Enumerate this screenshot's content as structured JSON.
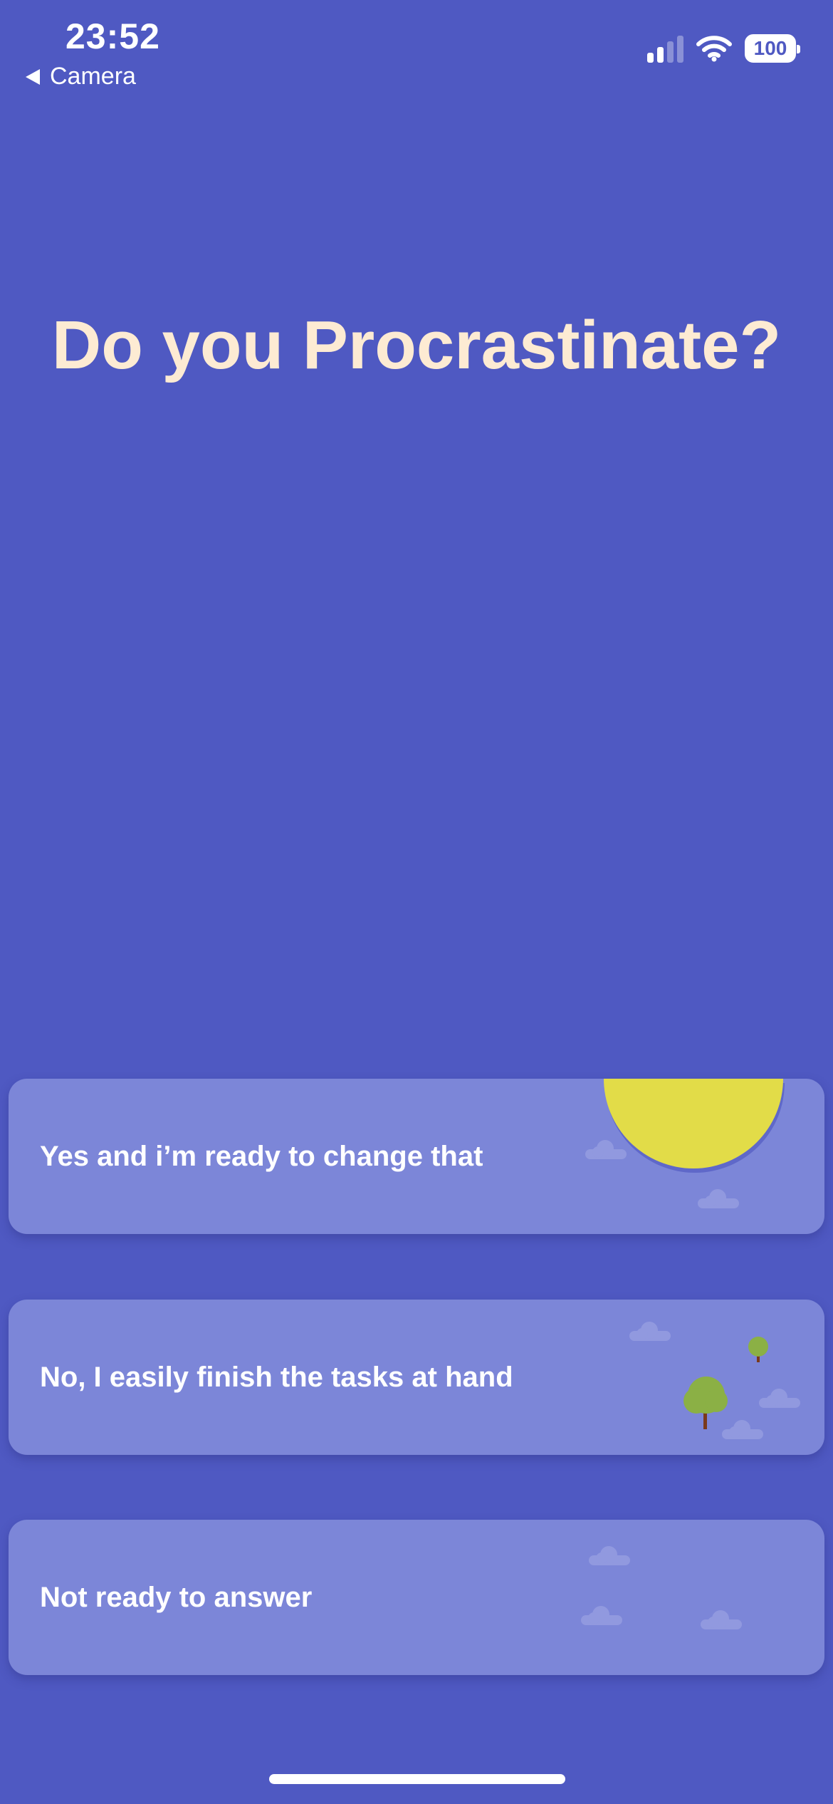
{
  "status_bar": {
    "time": "23:52",
    "back_label": "Camera",
    "battery": "100",
    "icons": [
      "signal-icon",
      "wifi-icon",
      "battery-icon"
    ]
  },
  "title": "Do you Procrastinate?",
  "options": [
    {
      "label": "Yes and i’m ready to change that",
      "art": "sun-illustration"
    },
    {
      "label": "No, I easily finish the tasks at hand",
      "art": "trees-illustration"
    },
    {
      "label": "Not ready to answer",
      "art": "clouds-illustration"
    }
  ],
  "colors": {
    "background": "#4F59C2",
    "card": "#7C86D8",
    "title": "#FDEBD3",
    "sun": "#E2DC48",
    "tree": "#8BB045",
    "cloud": "#9199DF"
  }
}
